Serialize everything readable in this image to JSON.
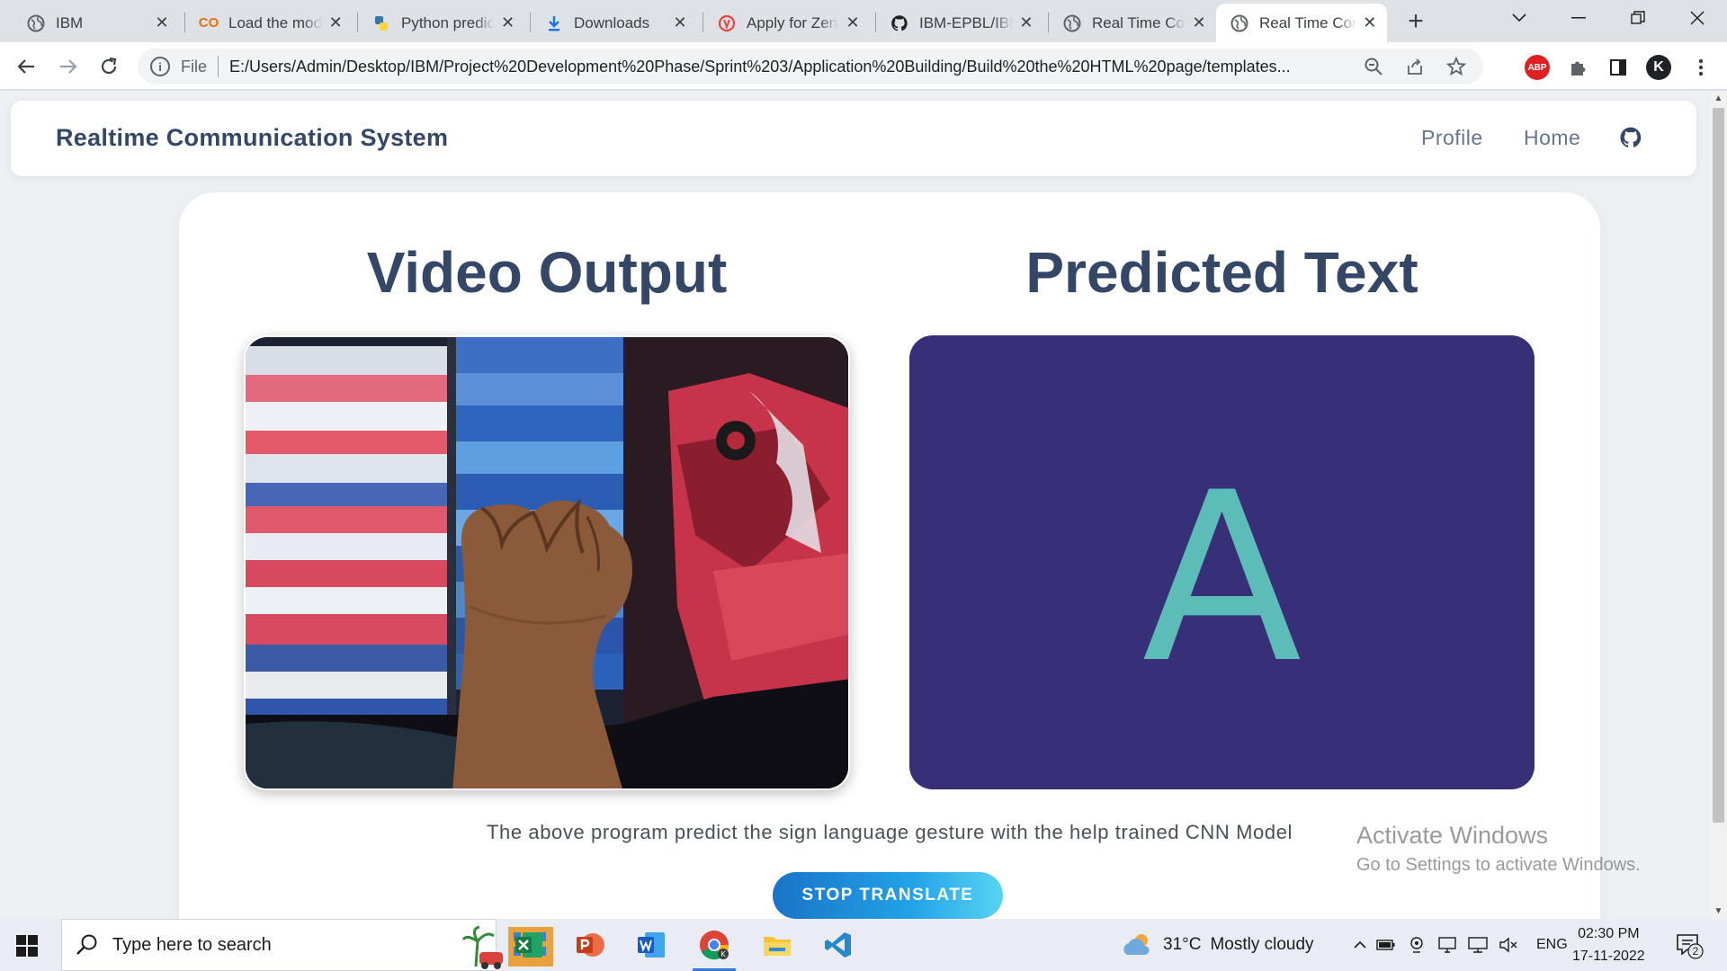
{
  "browser": {
    "tabs": [
      {
        "title": "IBM",
        "favicon": "globe-icon",
        "active": false
      },
      {
        "title": "Load the model",
        "favicon": "colab-icon",
        "active": false
      },
      {
        "title": "Python predict",
        "favicon": "python-icon",
        "active": false
      },
      {
        "title": "Downloads",
        "favicon": "download-icon",
        "active": false
      },
      {
        "title": "Apply for Zen",
        "favicon": "zenodo-icon",
        "active": false
      },
      {
        "title": "IBM-EPBL/IBM",
        "favicon": "github-icon",
        "active": false
      },
      {
        "title": "Real Time Com",
        "favicon": "globe-icon",
        "active": false
      },
      {
        "title": "Real Time Com",
        "favicon": "globe-icon",
        "active": true
      }
    ],
    "address": {
      "scheme_label": "File",
      "url": "E:/Users/Admin/Desktop/IBM/Project%20Development%20Phase/Sprint%203/Application%20Building/Build%20the%20HTML%20page/templates..."
    },
    "profile_initial": "K",
    "adblock_label": "ABP"
  },
  "page": {
    "brand": "Realtime Communication System",
    "nav": [
      {
        "label": "Profile"
      },
      {
        "label": "Home"
      }
    ],
    "video_heading": "Video Output",
    "predicted_heading": "Predicted Text",
    "predicted_letter": "A",
    "caption": "The above program predict the sign language gesture with the help trained CNN Model",
    "stop_button": "STOP TRANSLATE",
    "colors": {
      "heading": "#344767",
      "prediction_bg": "#372f77",
      "prediction_text": "#5bbcb8",
      "button_gradient_start": "#1a73c8",
      "button_gradient_end": "#58d4f2"
    }
  },
  "watermark": {
    "line1": "Activate Windows",
    "line2": "Go to Settings to activate Windows."
  },
  "taskbar": {
    "search_placeholder": "Type here to search",
    "apps": [
      "excel-icon",
      "powerpoint-icon",
      "word-icon",
      "chrome-icon",
      "file-explorer-icon",
      "vscode-icon"
    ],
    "weather": {
      "temp": "31°C",
      "condition": "Mostly cloudy"
    },
    "language": "ENG",
    "time": "02:30 PM",
    "date": "17-11-2022",
    "notification_count": "2"
  }
}
